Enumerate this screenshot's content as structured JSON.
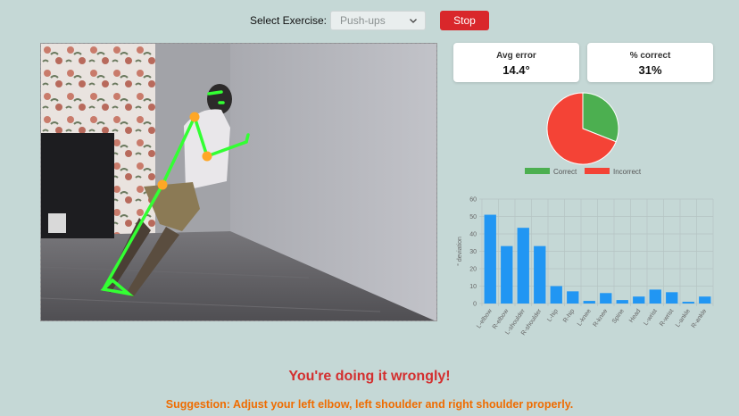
{
  "header": {
    "select_label": "Select Exercise:",
    "exercise_value": "Push-ups",
    "stop_label": "Stop"
  },
  "stats": {
    "avg_error_title": "Avg error",
    "avg_error_value": "14.4°",
    "pct_correct_title": "% correct",
    "pct_correct_value": "31%"
  },
  "messages": {
    "status": "You're doing it wrongly!",
    "suggestion": "Suggestion: Adjust your left elbow, left shoulder and right shoulder properly."
  },
  "colors": {
    "correct": "#4caf50",
    "incorrect": "#f44336",
    "bar": "#2196f3",
    "stop": "#d9272b"
  },
  "chart_data": [
    {
      "type": "pie",
      "categories": [
        "Correct",
        "Incorrect"
      ],
      "values": [
        31,
        69
      ],
      "legend_position": "bottom"
    },
    {
      "type": "bar",
      "categories": [
        "L-elbow",
        "R-elbow",
        "L-shoulder",
        "R-shoulder",
        "L-hip",
        "R-hip",
        "L-knee",
        "R-knee",
        "Spine",
        "Head",
        "L-wrist",
        "R-wrist",
        "L-ankle",
        "R-ankle"
      ],
      "values": [
        51,
        33,
        43.5,
        33,
        10,
        7,
        1.5,
        6,
        2,
        4,
        8,
        6.5,
        1,
        4
      ],
      "ylabel": "° deviation",
      "ylim": [
        0,
        60
      ],
      "yticks": [
        0,
        10,
        20,
        30,
        40,
        50,
        60
      ],
      "grid": true
    }
  ]
}
